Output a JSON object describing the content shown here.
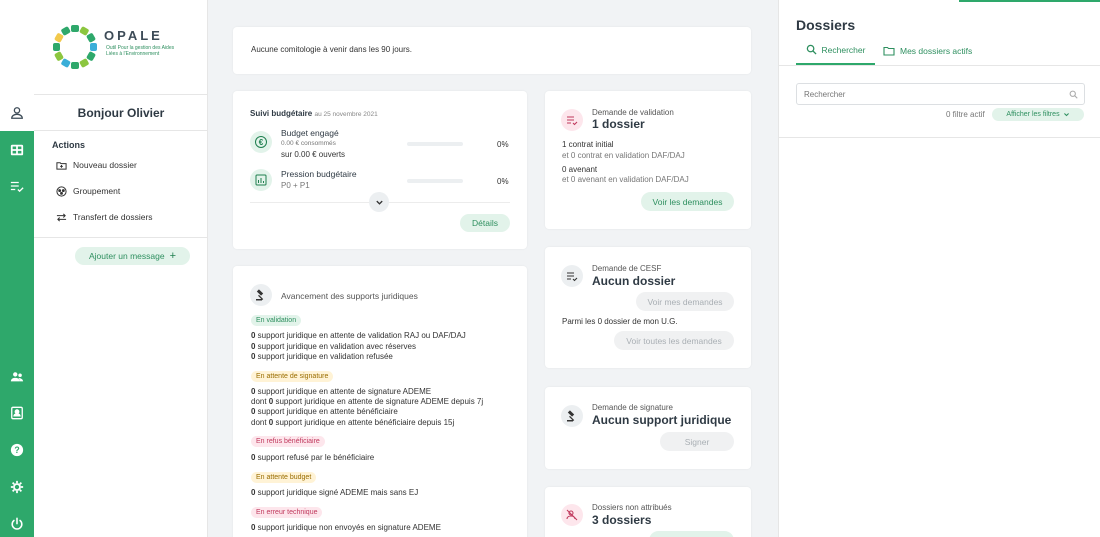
{
  "logo": {
    "name": "OPALE",
    "tagline": "Outil Pour la gestion des Aides Liées à l'Environnement"
  },
  "greeting": "Bonjour Olivier",
  "actions": {
    "title": "Actions",
    "items": [
      "Nouveau dossier",
      "Groupement",
      "Transfert de dossiers"
    ],
    "add_message": "Ajouter un message"
  },
  "comitologie": {
    "text": "Aucune comitologie à venir dans les 90 jours."
  },
  "budget": {
    "title": "Suivi budgétaire",
    "date": "au 25 novembre 2021",
    "engage": {
      "label": "Budget engagé",
      "line1": "0.00 € consommés",
      "line2": "sur 0.00 € ouverts",
      "percent": "0%",
      "progress": 0
    },
    "pression": {
      "label": "Pression budgétaire",
      "sub": "P0 + P1",
      "percent": "0%",
      "progress": 0
    },
    "details_button": "Détails"
  },
  "juridique": {
    "title": "Avancement des supports juridiques",
    "sections": [
      {
        "tag": "En validation",
        "lines": [
          {
            "n": "0",
            "t": " support juridique en attente de validation RAJ ou DAF/DAJ"
          },
          {
            "n": "0",
            "t": " support juridique en validation avec réserves"
          },
          {
            "n": "0",
            "t": " support juridique en validation refusée"
          }
        ]
      },
      {
        "tag": "En attente de signature",
        "lines": [
          {
            "n": "0",
            "t": " support juridique en attente de signature ADEME"
          },
          {
            "pre": "dont ",
            "n": "0",
            "t": " support juridique en attente de signature ADEME depuis 7j"
          },
          {
            "n": "0",
            "t": " support juridique en attente bénéficiaire"
          },
          {
            "pre": "dont ",
            "n": "0",
            "t": " support juridique en attente bénéficiaire depuis 15j"
          }
        ]
      },
      {
        "tag": "En refus bénéficiaire",
        "lines": [
          {
            "n": "0",
            "t": " support refusé par le bénéficiaire"
          }
        ]
      },
      {
        "tag": "En attente budget",
        "lines": [
          {
            "n": "0",
            "t": " support juridique signé ADEME mais sans EJ"
          }
        ]
      },
      {
        "tag": "En erreur technique",
        "lines": [
          {
            "n": "0",
            "t": " support juridique non envoyés en signature ADEME"
          }
        ]
      }
    ]
  },
  "validation": {
    "title": "Demande de validation",
    "count": "1 dossier",
    "line1": "1 contrat initial",
    "line2": "et 0 contrat en validation DAF/DAJ",
    "line3": "0 avenant",
    "line4": "et 0 avenant en validation DAF/DAJ",
    "button": "Voir les demandes"
  },
  "cesf": {
    "title": "Demande de CESF",
    "count": "Aucun dossier",
    "button1": "Voir mes demandes",
    "text": "Parmi les 0 dossier de mon U.G.",
    "button2": "Voir toutes les demandes"
  },
  "signature": {
    "title": "Demande de signature",
    "count": "Aucun support juridique",
    "button": "Signer"
  },
  "non_attribues": {
    "title": "Dossiers non attribués",
    "count": "3 dossiers"
  },
  "dossiers": {
    "title": "Dossiers",
    "tabs": [
      "Rechercher",
      "Mes dossiers actifs"
    ],
    "search_placeholder": "Rechercher",
    "filter_count": "0 filtre actif",
    "filter_button": "Afficher les filtres"
  },
  "colors": {
    "accent": "#2ea86b",
    "accent_light": "#e2f3ea",
    "pink": "#fde6ec"
  }
}
